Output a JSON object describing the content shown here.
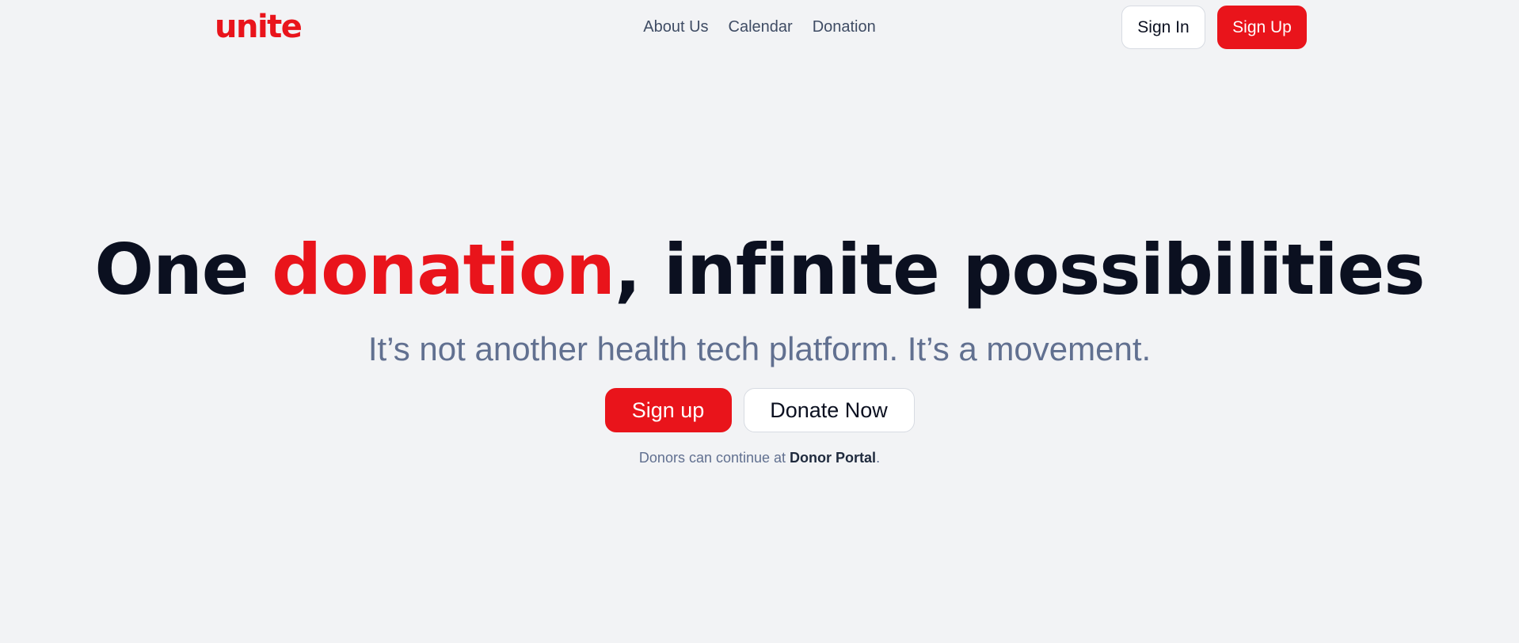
{
  "brand": {
    "logo": "unite",
    "accent_color": "#e9141b"
  },
  "nav": {
    "items": [
      {
        "label": "About Us"
      },
      {
        "label": "Calendar"
      },
      {
        "label": "Donation"
      }
    ]
  },
  "auth": {
    "sign_in": "Sign In",
    "sign_up": "Sign Up"
  },
  "hero": {
    "title_part1": "One ",
    "title_accent": "donation",
    "title_part2": ", infinite possibilities",
    "subtitle": "It’s not another health tech platform. It’s a movement.",
    "cta_signup": "Sign up",
    "cta_donate": "Donate Now",
    "note_prefix": "Donors can continue at ",
    "note_link": "Donor Portal",
    "note_suffix": "."
  }
}
